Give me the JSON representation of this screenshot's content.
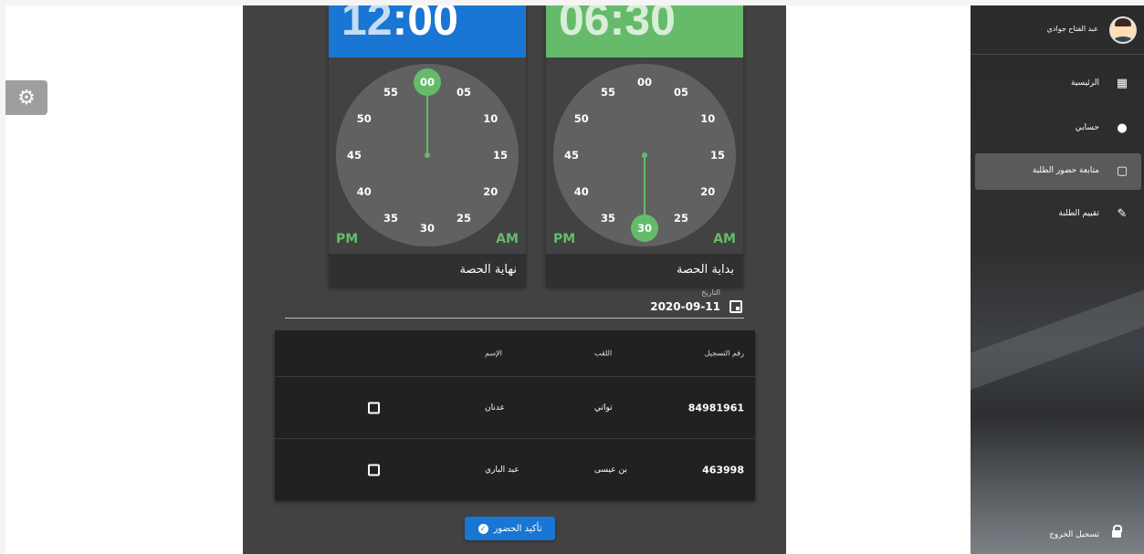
{
  "settings": {
    "icon": "gear-icon"
  },
  "end_card": {
    "time": "12:00",
    "hour": "12",
    "minute": "00",
    "header_color": "#1976d2",
    "label": "نهاية الحصة",
    "am": "AM",
    "pm": "PM",
    "dial": [
      "00",
      "05",
      "10",
      "15",
      "20",
      "25",
      "30",
      "35",
      "40",
      "45",
      "50",
      "55"
    ],
    "selected_minute": "00"
  },
  "start_card": {
    "time": "06:30",
    "hour": "06",
    "minute": "30",
    "header_color": "#66bb6a",
    "label": "بداية الحصة",
    "am": "AM",
    "pm": "PM",
    "dial": [
      "00",
      "05",
      "10",
      "15",
      "20",
      "25",
      "30",
      "35",
      "40",
      "45",
      "50",
      "55"
    ],
    "selected_minute": "30"
  },
  "date": {
    "label": "التاريخ",
    "value": "2020-09-11",
    "icon": "calendar-icon"
  },
  "table": {
    "headers": {
      "reg": "رقم التسجيل",
      "last": "اللقب",
      "first": "الإسم"
    },
    "rows": [
      {
        "reg": "84981961",
        "last": "تواتي",
        "first": "عدنان",
        "checked": false
      },
      {
        "reg": "463998",
        "last": "بن عيسى",
        "first": "عبد الباري",
        "checked": false
      }
    ]
  },
  "confirm_button": {
    "label": "تأكيد الحضور",
    "icon": "check-circle-icon",
    "color": "#1976d2"
  },
  "sidebar": {
    "user_name": "عبد الفتاح جوادي",
    "items": [
      {
        "label": "الرئيسية",
        "icon": "dashboard-icon"
      },
      {
        "label": "حسابي",
        "icon": "person-icon"
      },
      {
        "label": "متابعة حضور الطلبة",
        "icon": "clipboard-icon",
        "active": true
      },
      {
        "label": "تقييم الطلبة",
        "icon": "pencil-icon"
      }
    ],
    "logout": {
      "label": "تسجيل الخروج",
      "icon": "lock-icon"
    }
  },
  "colors": {
    "accent_green": "#66bb6a",
    "accent_blue": "#1976d2",
    "panel_dark": "#424242"
  }
}
